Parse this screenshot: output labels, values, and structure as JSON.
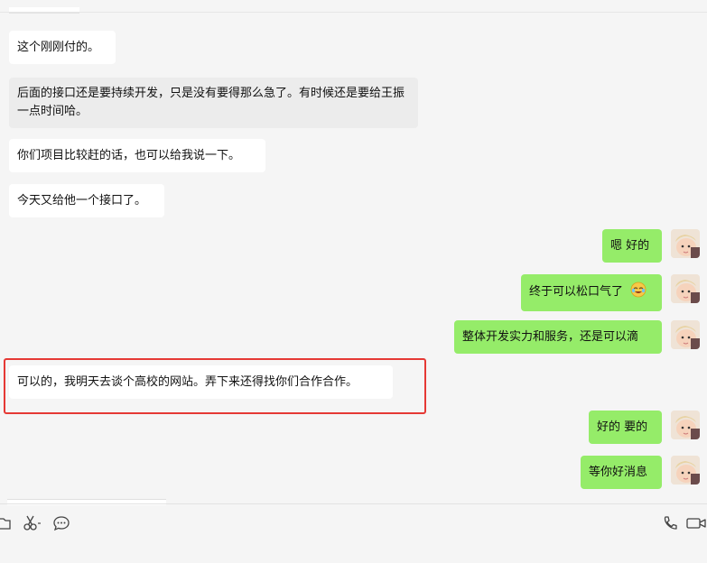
{
  "messages": [
    {
      "side": "left",
      "text": "这个刚刚付的。"
    },
    {
      "side": "left",
      "text": "后面的接口还是要持续开发，只是没有要得那么急了。有时候还是要给王振一点时间哈。"
    },
    {
      "side": "left",
      "text": "你们项目比较赶的话，也可以给我说一下。"
    },
    {
      "side": "left",
      "text": "今天又给他一个接口了。"
    },
    {
      "side": "right",
      "text": "嗯 好的"
    },
    {
      "side": "right",
      "text": "终于可以松口气了",
      "emoji": "laughing-tears-emoji"
    },
    {
      "side": "right",
      "text": "整体开发实力和服务，还是可以滴"
    },
    {
      "side": "left",
      "text": "可以的，我明天去谈个高校的网站。弄下来还得找你们合作合作。",
      "highlighted": true
    },
    {
      "side": "right",
      "text": "好的 要的"
    },
    {
      "side": "right",
      "text": "等你好消息"
    }
  ],
  "colors": {
    "background": "#f5f5f5",
    "bubble_left": "#ffffff",
    "bubble_right": "#95ec69",
    "highlight": "#e53935"
  },
  "toolbar": {
    "left_icons": [
      "folder-icon",
      "scissors-icon",
      "chat-bubble-icon"
    ],
    "right_icons": [
      "phone-icon",
      "video-call-icon"
    ]
  }
}
